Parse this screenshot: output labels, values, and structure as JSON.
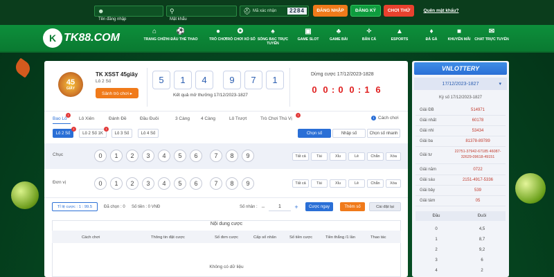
{
  "header": {
    "username_placeholder": "Tên đăng nhập",
    "password_placeholder": "Mật khẩu",
    "captcha_placeholder": "Mã xác nhận",
    "captcha_code": "2284",
    "login_label": "ĐĂNG NHẬP",
    "register_label": "ĐĂNG KÝ",
    "trial_label": "CHƠI THỬ",
    "forgot_label": "Quên mật khẩu?"
  },
  "brand": {
    "name": "TK88.COM"
  },
  "nav": [
    {
      "label": "TRANG CHỦ",
      "icon": "home-icon"
    },
    {
      "label": "THỂ THAO",
      "label_pre": "THI ĐẤU",
      "icon": "soccer-icon"
    },
    {
      "label": "TRÒ CHƠI",
      "icon": "game-icon"
    },
    {
      "label": "TRÒ CHƠI XỔ SỐ",
      "icon": "lottery-icon"
    },
    {
      "label": "SÒNG BẠC TRỰC TUYẾN",
      "icon": "casino-icon"
    },
    {
      "label": "GAME SLOT",
      "icon": "slot-icon"
    },
    {
      "label": "GAME BÀI",
      "icon": "cards-icon"
    },
    {
      "label": "BẮN CÁ",
      "icon": "fish-icon"
    },
    {
      "label": "ESPORTS",
      "icon": "gamepad-icon"
    },
    {
      "label": "ĐÁ GÀ",
      "icon": "rooster-icon"
    },
    {
      "label": "KHUYẾN MÃI",
      "icon": "gift-icon"
    },
    {
      "label": "CHAT TRỰC TUYẾN",
      "icon": "chat-icon"
    }
  ],
  "game": {
    "title": "TK XSST 45giây",
    "subtitle": "Lô 2 Số",
    "lobby_button": "Sảnh trò chơi ▸",
    "badge_text": "45",
    "badge_sub": "GIÂY",
    "result_numbers": [
      "5",
      "1",
      "4",
      "9",
      "7",
      "1"
    ],
    "result_caption": "Kết quả mở thưởng 17/12/2023-1827",
    "stop_text": "Dừng cược 17/12/2023-1828",
    "countdown": [
      "0",
      "0",
      ":",
      "0",
      "0",
      ":",
      "1",
      "6"
    ]
  },
  "tabs": [
    "Bao Lô",
    "Lô Xiên",
    "Đánh Đề",
    "Đầu Đuôi",
    "3 Càng",
    "4 Càng",
    "Lô Trượt",
    "Trò Chơi Thú Vị"
  ],
  "how_to_play": "Cách chơi",
  "subtabs": [
    "Lô 2 Số",
    "Lô 2 Số 1K",
    "Lô 3 Số",
    "Lô 4 Số"
  ],
  "select_modes": [
    "Chọn số",
    "Nhập số",
    "Chọn số nhanh"
  ],
  "rows": [
    {
      "label": "Chục",
      "balls": [
        "0",
        "1",
        "2",
        "3",
        "4",
        "5",
        "6",
        "7",
        "8",
        "9"
      ]
    },
    {
      "label": "Đơn vị",
      "balls": [
        "0",
        "1",
        "2",
        "3",
        "4",
        "5",
        "6",
        "7",
        "8",
        "9"
      ]
    }
  ],
  "filters": [
    "Tất cả",
    "Tài",
    "Xỉu",
    "Lẻ",
    "Chẵn",
    "Xóa"
  ],
  "bet": {
    "ratio_label": "Tỉ lệ cược : 1 : 99.5",
    "chosen": "Đã chọn : 0",
    "money": "Số tiền : 0 VNĐ",
    "multiplier_label": "Số nhân :",
    "multiplier_value": "1",
    "minus": "−",
    "plus": "+",
    "bet_now": "Cược ngay",
    "add_number": "Thêm số",
    "reset": "Cài đặt lại"
  },
  "table": {
    "title": "Nội dung cược",
    "headers": [
      "Cách chơi",
      "Thông tin đặt cược",
      "Số đơn cược",
      "Cấp số nhân",
      "Số tiền cược",
      "Tiền thắng /1 lần",
      "Thao tác"
    ],
    "empty": "Không có dữ liệu"
  },
  "results": {
    "brand": "VNLOTTERY",
    "period": "17/12/2023-1827",
    "period_label": "Kỳ số 17/12/2023-1827",
    "rows": [
      {
        "k": "Giải ĐB",
        "v": "514971"
      },
      {
        "k": "Giải nhất",
        "v": "60178"
      },
      {
        "k": "Giải nhì",
        "v": "53434"
      },
      {
        "k": "Giải ba",
        "v": "81378-89789"
      },
      {
        "k": "Giải tư",
        "v": "22751-37942-67185 46087-32629-09618-49151"
      },
      {
        "k": "Giải năm",
        "v": "0722"
      },
      {
        "k": "Giải sáu",
        "v": "2151-4917-5336"
      },
      {
        "k": "Giải bảy",
        "v": "539"
      },
      {
        "k": "Giải tám",
        "v": "05"
      }
    ],
    "head_tail_headers": [
      "Đầu",
      "Đuôi"
    ],
    "head_tail": [
      [
        "0",
        "4,5"
      ],
      [
        "1",
        "8,7"
      ],
      [
        "2",
        "9,2"
      ],
      [
        "3",
        "6"
      ],
      [
        "4",
        "2"
      ]
    ]
  },
  "colors": {
    "brand_green": "#0a7a31",
    "orange": "#f07a1a",
    "blue": "#3d7be0",
    "red": "#e02020"
  }
}
